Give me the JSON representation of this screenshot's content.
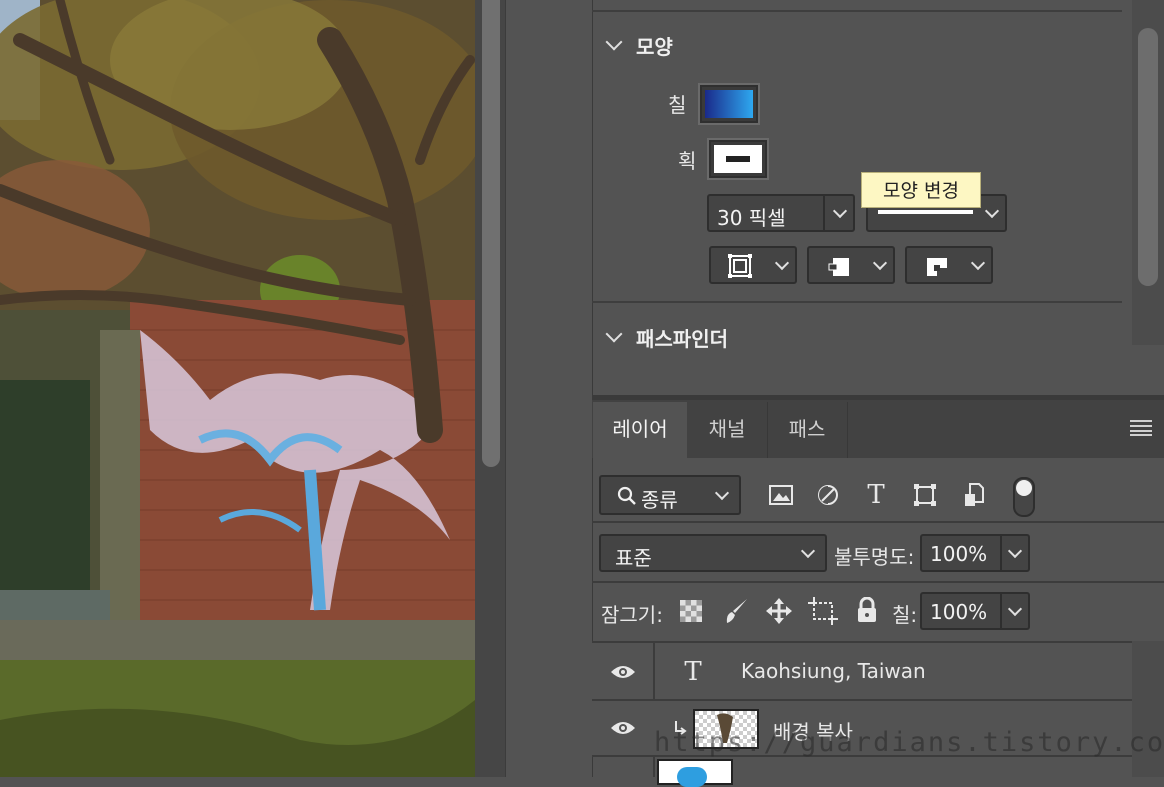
{
  "properties": {
    "shape_section_title": "모양",
    "fill_label": "칠",
    "stroke_label": "획",
    "stroke_width": "30 픽셀",
    "tooltip": "모양 변경",
    "pathfinder_section_title": "패스파인더",
    "fill_gradient": [
      "#1a2a8a",
      "#2ea8f0"
    ],
    "stroke_color": "#ffffff"
  },
  "layers_panel": {
    "tabs": [
      {
        "label": "레이어",
        "active": true
      },
      {
        "label": "채널",
        "active": false
      },
      {
        "label": "패스",
        "active": false
      }
    ],
    "filter_label": "종류",
    "blend_mode": "표준",
    "opacity_label": "불투명도:",
    "opacity_value": "100%",
    "lock_label": "잠그기:",
    "fill_label": "칠:",
    "fill_value": "100%",
    "layers": [
      {
        "name": "Kaohsiung, Taiwan",
        "type": "text",
        "visible": true
      },
      {
        "name": "배경 복사",
        "type": "image",
        "visible": true,
        "clipped": true
      },
      {
        "name": "",
        "type": "shape",
        "visible": true
      }
    ]
  },
  "watermark": "https://guardians.tistory.com/",
  "colors": {
    "panel_bg": "#535353",
    "tab_bar_bg": "#424242",
    "tooltip_bg": "#fdf7c3"
  }
}
